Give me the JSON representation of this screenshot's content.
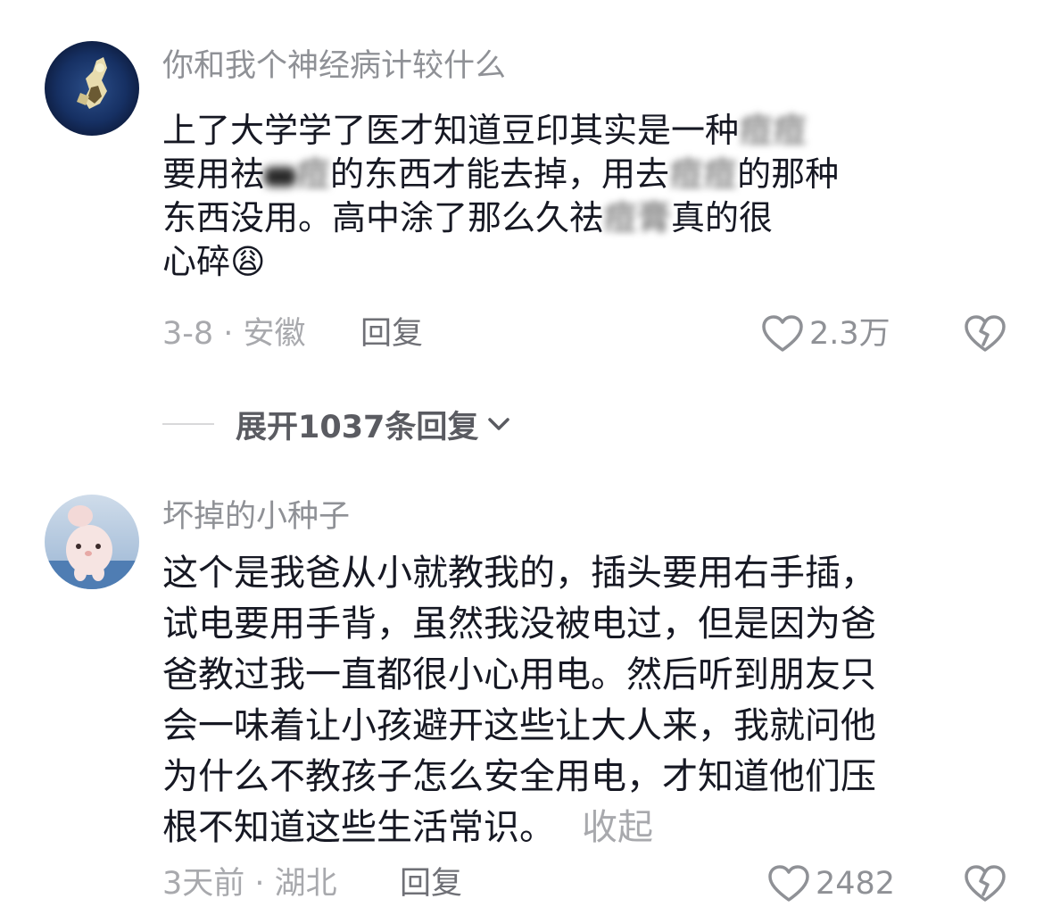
{
  "comments": [
    {
      "username": "你和我个神经病计较什么",
      "avatar_icon": "anime-avatar-icon",
      "lines": [
        "上了大学学了医才知道豆印其实是一种",
        "要用祛",
        "的东西才能去掉，用去",
        "的那种",
        "东西没用。高中涂了那么久祛",
        "真的很",
        "心碎"
      ],
      "blurred": [
        "痘痘",
        "痘",
        "痘痘",
        "痘膏"
      ],
      "emoji": "😩",
      "date_location": "3-8 · 安徽",
      "reply_label": "回复",
      "like_count": "2.3万"
    },
    {
      "username": "坏掉的小种子",
      "avatar_icon": "plush-toy-avatar-icon",
      "lines": [
        "这个是我爸从小就教我的，插头要用右手插，",
        "试电要用手背，虽然我没被电过，但是因为爸",
        "爸教过我一直都很小心用电。然后听到朋友只",
        "会一味着让小孩避开这些让大人来，我就问他",
        "为什么不教孩子怎么安全用电，才知道他们压",
        "根不知道这些生活常识。"
      ],
      "collapse_label": "收起",
      "date_location": "3天前 · 湖北",
      "reply_label": "回复",
      "like_count": "2482"
    }
  ],
  "expand_replies": {
    "label": "展开1037条回复"
  },
  "icons": {
    "like": "heart-outline-icon",
    "dislike": "broken-heart-icon",
    "expand": "chevron-down-icon"
  },
  "colors": {
    "text": "#161823",
    "username": "#8f9196",
    "meta": "#a8a9ad"
  }
}
